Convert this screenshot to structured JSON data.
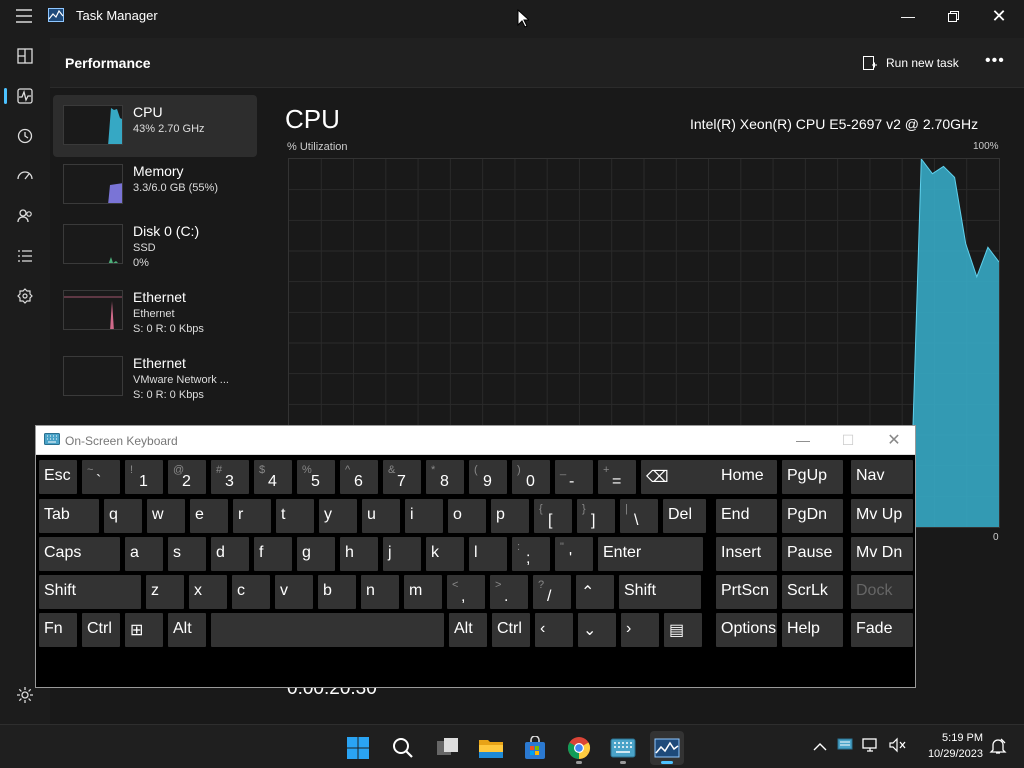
{
  "window": {
    "title": "Task Manager"
  },
  "header": {
    "title": "Performance",
    "run_task_label": "Run new task"
  },
  "sidebar": {
    "items": [
      "processes-icon",
      "performance-icon",
      "app-history-icon",
      "startup-apps-icon",
      "users-icon",
      "details-icon",
      "services-icon"
    ],
    "settings": "settings-icon"
  },
  "resources": [
    {
      "name": "CPU",
      "line1": "43% 2.70 GHz",
      "line2": "",
      "line3": "",
      "color": "#36a8c4"
    },
    {
      "name": "Memory",
      "line1": "3.3/6.0 GB (55%)",
      "line2": "",
      "line3": "",
      "color": "#7a74d6"
    },
    {
      "name": "Disk 0 (C:)",
      "line1": "SSD",
      "line2": "0%",
      "line3": "",
      "color": "#4caf7a"
    },
    {
      "name": "Ethernet",
      "line1": "Ethernet",
      "line2": "S: 0 R: 0 Kbps",
      "line3": "",
      "color": "#d06a8a"
    },
    {
      "name": "Ethernet",
      "line1": "VMware Network ...",
      "line2": "S: 0 R: 0 Kbps",
      "line3": "",
      "color": "#d06a8a"
    }
  ],
  "detail": {
    "title": "CPU",
    "model": "Intel(R) Xeon(R) CPU E5-2697 v2 @ 2.70GHz",
    "util_label": "% Utilization",
    "util_max": "100%",
    "util_min": "0",
    "uptime": "0:00:20:30",
    "color": "#36a8c4"
  },
  "chart_data": {
    "type": "area",
    "ylim": [
      0,
      100
    ],
    "values": [
      0,
      0,
      0,
      0,
      0,
      0,
      0,
      0,
      0,
      0,
      0,
      0,
      0,
      0,
      0,
      0,
      0,
      0,
      0,
      0,
      0,
      0,
      0,
      0,
      0,
      0,
      0,
      0,
      0,
      0,
      0,
      0,
      0,
      0,
      0,
      0,
      0,
      0,
      0,
      0,
      0,
      0,
      0,
      0,
      0,
      0,
      0,
      0,
      0,
      0,
      0,
      0,
      0,
      0,
      0,
      0,
      4,
      100,
      96,
      98,
      95,
      77,
      68,
      76,
      72
    ]
  },
  "osk": {
    "title": "On-Screen Keyboard",
    "rows": [
      [
        {
          "l": "Esc",
          "w": 38
        },
        {
          "s": "~",
          "b": "`",
          "w": 38
        },
        {
          "s": "!",
          "b": "1",
          "w": 38
        },
        {
          "s": "@",
          "b": "2",
          "w": 38
        },
        {
          "s": "#",
          "b": "3",
          "w": 38
        },
        {
          "s": "$",
          "b": "4",
          "w": 38
        },
        {
          "s": "%",
          "b": "5",
          "w": 38
        },
        {
          "s": "^",
          "b": "6",
          "w": 38
        },
        {
          "s": "&",
          "b": "7",
          "w": 38
        },
        {
          "s": "*",
          "b": "8",
          "w": 38
        },
        {
          "s": "(",
          "b": "9",
          "w": 38
        },
        {
          "s": ")",
          "b": "0",
          "w": 38
        },
        {
          "s": "_",
          "b": "-",
          "w": 38
        },
        {
          "s": "+",
          "b": "=",
          "w": 38
        },
        {
          "l": "⌫",
          "w": 88
        }
      ],
      [
        {
          "l": "Tab",
          "w": 60
        },
        {
          "l": "q",
          "w": 38
        },
        {
          "l": "w",
          "w": 38
        },
        {
          "l": "e",
          "w": 38
        },
        {
          "l": "r",
          "w": 38
        },
        {
          "l": "t",
          "w": 38
        },
        {
          "l": "y",
          "w": 38
        },
        {
          "l": "u",
          "w": 38
        },
        {
          "l": "i",
          "w": 38
        },
        {
          "l": "o",
          "w": 38
        },
        {
          "l": "p",
          "w": 38
        },
        {
          "s": "{",
          "b": "[",
          "w": 38
        },
        {
          "s": "}",
          "b": "]",
          "w": 38
        },
        {
          "s": "|",
          "b": "\\",
          "w": 38
        },
        {
          "l": "Del",
          "w": 43
        }
      ],
      [
        {
          "l": "Caps",
          "w": 81
        },
        {
          "l": "a",
          "w": 38
        },
        {
          "l": "s",
          "w": 38
        },
        {
          "l": "d",
          "w": 38
        },
        {
          "l": "f",
          "w": 38
        },
        {
          "l": "g",
          "w": 38
        },
        {
          "l": "h",
          "w": 38
        },
        {
          "l": "j",
          "w": 38
        },
        {
          "l": "k",
          "w": 38
        },
        {
          "l": "l",
          "w": 38
        },
        {
          "s": ":",
          "b": ";",
          "w": 38
        },
        {
          "s": "\"",
          "b": "'",
          "w": 38
        },
        {
          "l": "Enter",
          "w": 105
        }
      ],
      [
        {
          "l": "Shift",
          "w": 102
        },
        {
          "l": "z",
          "w": 38
        },
        {
          "l": "x",
          "w": 38
        },
        {
          "l": "c",
          "w": 38
        },
        {
          "l": "v",
          "w": 38
        },
        {
          "l": "b",
          "w": 38
        },
        {
          "l": "n",
          "w": 38
        },
        {
          "l": "m",
          "w": 38
        },
        {
          "s": "<",
          "b": ",",
          "w": 38
        },
        {
          "s": ">",
          "b": ".",
          "w": 38
        },
        {
          "s": "?",
          "b": "/",
          "w": 38
        },
        {
          "l": "⌃",
          "w": 38
        },
        {
          "l": "Shift",
          "w": 82
        }
      ],
      [
        {
          "l": "Fn",
          "w": 38
        },
        {
          "l": "Ctrl",
          "w": 38
        },
        {
          "l": "⊞",
          "w": 38
        },
        {
          "l": "Alt",
          "w": 38
        },
        {
          "l": "",
          "w": 233
        },
        {
          "l": "Alt",
          "w": 38
        },
        {
          "l": "Ctrl",
          "w": 38
        },
        {
          "l": "‹",
          "w": 38
        },
        {
          "l": "⌄",
          "w": 38
        },
        {
          "l": "›",
          "w": 38
        },
        {
          "l": "▤",
          "w": 38
        }
      ]
    ],
    "right": [
      [
        {
          "l": "Home"
        },
        {
          "l": "PgUp"
        },
        {
          "l": "Nav"
        }
      ],
      [
        {
          "l": "End"
        },
        {
          "l": "PgDn"
        },
        {
          "l": "Mv Up"
        }
      ],
      [
        {
          "l": "Insert"
        },
        {
          "l": "Pause"
        },
        {
          "l": "Mv Dn"
        }
      ],
      [
        {
          "l": "PrtScn"
        },
        {
          "l": "ScrLk"
        },
        {
          "l": "Dock",
          "dim": true
        }
      ],
      [
        {
          "l": "Options"
        },
        {
          "l": "Help"
        },
        {
          "l": "Fade"
        }
      ]
    ]
  },
  "taskbar": {
    "apps": [
      "start-icon",
      "search-icon",
      "task-view-icon",
      "file-explorer-icon",
      "store-icon",
      "chrome-icon",
      "osk-app-icon",
      "task-manager-app-icon"
    ],
    "time": "5:19 PM",
    "date": "10/29/2023"
  }
}
